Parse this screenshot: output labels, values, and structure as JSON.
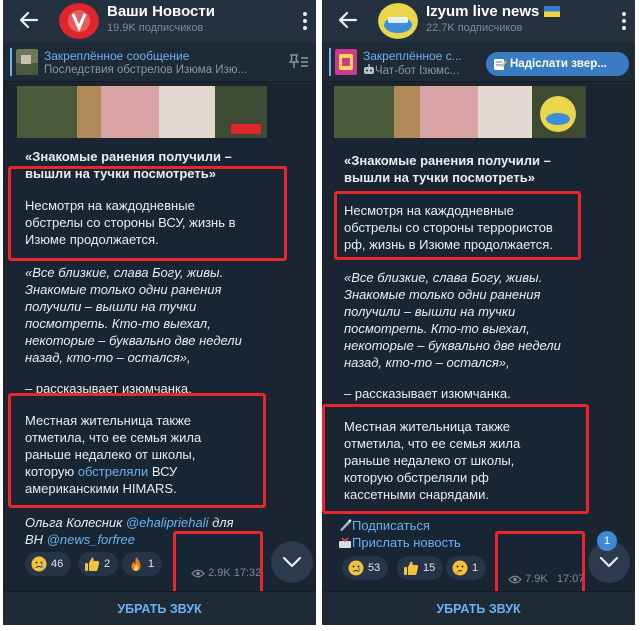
{
  "left": {
    "header": {
      "title": "Ваши Новости",
      "subtitle": "19.9K подписчиков"
    },
    "pinned": {
      "title": "Закреплённое сообщение",
      "text": "Последствия обстрелов Изюма  Изю..."
    },
    "post": {
      "title_1": "«Знакомые ранения получили –",
      "title_2": "вышли на тучки посмотреть»",
      "p1_1": "Несмотря на каждодневные",
      "p1_2": "обстрелы со стороны ВСУ, жизнь в",
      "p1_3": "Изюме продолжается.",
      "q_1": "«Все близкие, слава Богу, живы.",
      "q_2": "Знакомые только одни ранения",
      "q_3": "получили – вышли на тучки",
      "q_4": "посмотреть. Кто-то выехал,",
      "q_5": "некоторые – буквально две недели",
      "q_6": "назад, кто-то – остался»,",
      "says": "– рассказывает изюмчанка.",
      "p2_1": "Местная жительница также",
      "p2_2": "отметила, что ее семья жила",
      "p2_3": "раньше недалеко от школы,",
      "p2_4_a": "которую ",
      "p2_4_link": "обстреляли",
      "p2_4_b": " ВСУ",
      "p2_5": "американскими HIMARS.",
      "author_1": "Ольга Колесник ",
      "author_link_1": "@ehalipriehali",
      "author_2": " для",
      "author_3": "ВН ",
      "author_link_2": "@news_forfree"
    },
    "reactions": [
      {
        "icon": "crying-face-emoji",
        "count": "46"
      },
      {
        "icon": "thumbs-up-emoji",
        "count": "2"
      },
      {
        "icon": "fire-emoji",
        "count": "1"
      }
    ],
    "stats": {
      "views": "2.9K",
      "time": "17:32"
    },
    "bottom_button": "УБРАТЬ ЗВУК",
    "colors": {
      "avatar": "#e0262c",
      "accent": "#6ab2f2",
      "highlight": "#e8262c"
    }
  },
  "right": {
    "header": {
      "title": "Izyum live news",
      "subtitle": "22.7K подписчиков"
    },
    "pinned": {
      "title": "Закреплённое с...",
      "text": "Чат-бот Ізюмс..."
    },
    "notify_button": "Надіслати звер...",
    "post": {
      "title_1": "«Знакомые ранения получили –",
      "title_2": "вышли на тучки посмотреть»",
      "p1_1": "Несмотря на каждодневные",
      "p1_2": "обстрелы со стороны террористов",
      "p1_3": "рф, жизнь в Изюме продолжается.",
      "q_1": "«Все близкие, слава Богу, живы.",
      "q_2": "Знакомые только одни ранения",
      "q_3": "получили – вышли на тучки",
      "q_4": "посмотреть. Кто-то выехал,",
      "q_5": "некоторые – буквально две недели",
      "q_6": "назад, кто-то – остался»,",
      "says": "– рассказывает изюмчанка.",
      "p2_1": "Местная жительница также",
      "p2_2": "отметила, что ее семья жила",
      "p2_3": "раньше недалеко от школы,",
      "p2_4": "которую обстреляли рф",
      "p2_5": "кассетными снарядами.",
      "subscribe": "Подписаться",
      "send_news": "Прислать новость"
    },
    "reactions": [
      {
        "icon": "crying-face-emoji",
        "count": "53"
      },
      {
        "icon": "thumbs-up-emoji",
        "count": "15"
      },
      {
        "icon": "thinking-face-emoji",
        "count": "1"
      }
    ],
    "stats": {
      "views": "7.9K",
      "time": "17:07"
    },
    "unread_badge": "1",
    "bottom_button": "УБРАТЬ ЗВУК",
    "colors": {
      "avatar": "#e9d64a",
      "accent": "#6ab2f2",
      "highlight": "#e8262c"
    }
  }
}
